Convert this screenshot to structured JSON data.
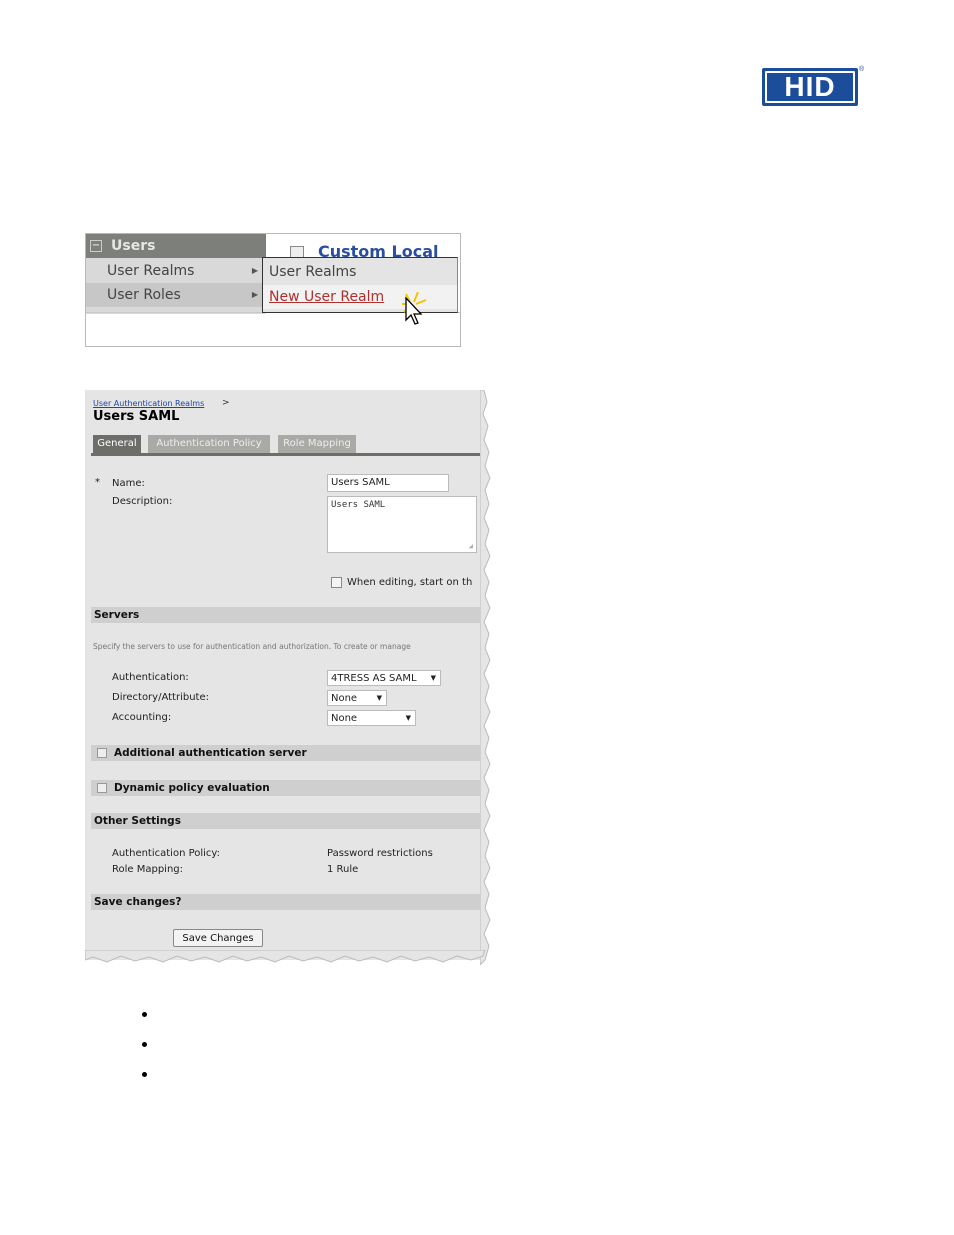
{
  "logo": {
    "text": "HID",
    "reg": "®"
  },
  "menu": {
    "header": "Users",
    "items": [
      {
        "label": "User Realms"
      },
      {
        "label": "User Roles"
      }
    ],
    "background_title": "Custom Local",
    "submenu": [
      {
        "label": "User Realms"
      },
      {
        "label": "New User Realm"
      }
    ]
  },
  "form": {
    "breadcrumb": "User Authentication Realms",
    "breadcrumb_sep": ">",
    "title": "Users SAML",
    "tabs": [
      {
        "label": "General",
        "active": true
      },
      {
        "label": "Authentication Policy"
      },
      {
        "label": "Role Mapping"
      }
    ],
    "required_mark": "*",
    "name_label": "Name:",
    "name_value": "Users SAML",
    "description_label": "Description:",
    "description_value": "Users SAML",
    "edit_option_label": "When editing, start on th",
    "sections": {
      "servers": "Servers",
      "additional": "Additional authentication server",
      "dynamic": "Dynamic policy evaluation",
      "other": "Other Settings",
      "save": "Save changes?"
    },
    "servers_hint": "Specify the servers to use for authentication and authorization. To create or manage",
    "authentication_label": "Authentication:",
    "authentication_value": "4TRESS AS SAML",
    "directory_label": "Directory/Attribute:",
    "directory_value": "None",
    "accounting_label": "Accounting:",
    "accounting_value": "None",
    "auth_policy_label": "Authentication Policy:",
    "auth_policy_value": "Password restrictions",
    "role_mapping_label": "Role Mapping:",
    "role_mapping_value": "1 Rule",
    "save_button": "Save Changes"
  }
}
